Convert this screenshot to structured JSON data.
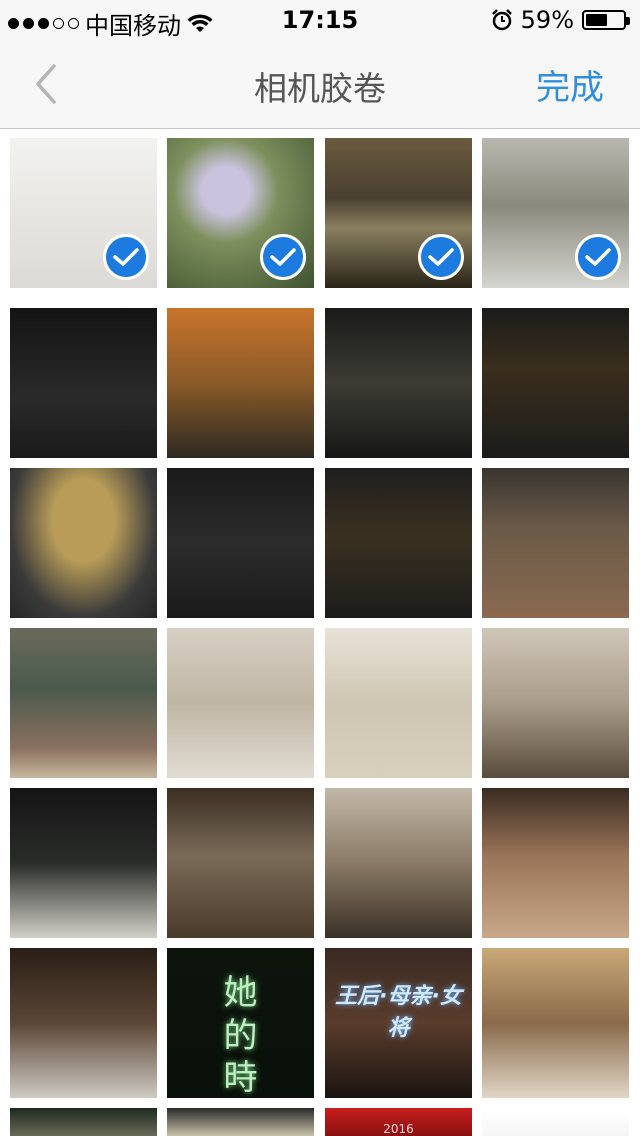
{
  "status_bar": {
    "carrier": "中国移动",
    "time": "17:15",
    "battery_percent": "59%",
    "battery_level": 0.59
  },
  "nav": {
    "title": "相机胶卷",
    "done_label": "完成"
  },
  "photos": [
    {
      "selected": true
    },
    {
      "selected": true
    },
    {
      "selected": true
    },
    {
      "selected": true
    },
    {
      "selected": false
    },
    {
      "selected": false
    },
    {
      "selected": false
    },
    {
      "selected": false
    },
    {
      "selected": false
    },
    {
      "selected": false
    },
    {
      "selected": false
    },
    {
      "selected": false
    },
    {
      "selected": false
    },
    {
      "selected": false
    },
    {
      "selected": false
    },
    {
      "selected": false
    },
    {
      "selected": false
    },
    {
      "selected": false
    },
    {
      "selected": false
    },
    {
      "selected": false
    },
    {
      "selected": false
    },
    {
      "selected": false
    },
    {
      "selected": false
    },
    {
      "selected": false
    },
    {
      "selected": false
    },
    {
      "selected": false
    },
    {
      "selected": false
    },
    {
      "selected": false
    }
  ],
  "photo_texts": {
    "calligraphy": "她\n的\n時\n代",
    "banner": "王后·母亲·女将",
    "year": "2016"
  }
}
